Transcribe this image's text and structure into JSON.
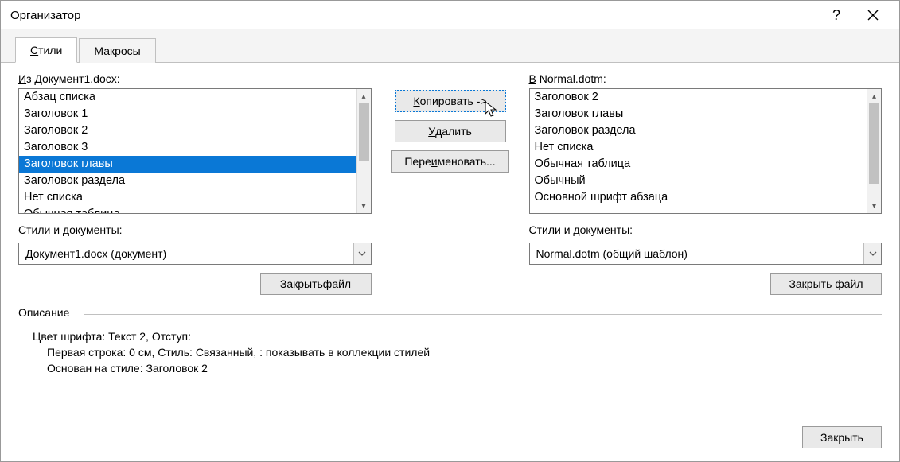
{
  "window": {
    "title": "Организатор",
    "help": "?",
    "close": "✕"
  },
  "tabs": {
    "styles_prefix": "С",
    "styles_rest": "тили",
    "macros_prefix": "М",
    "macros_rest": "акросы"
  },
  "left": {
    "label_prefix": "И",
    "label_rest": "з Документ1.docx:",
    "items": [
      "Абзац списка",
      "Заголовок 1",
      "Заголовок 2",
      "Заголовок 3",
      "Заголовок главы",
      "Заголовок раздела",
      "Нет списка",
      "Обычная таблица"
    ],
    "selected_index": 4,
    "sd_label": "Стили и документы:",
    "sd_value": "Документ1.docx (документ)",
    "close_file_pre": "Закрыть ",
    "close_file_ul": "ф",
    "close_file_post": "айл"
  },
  "mid": {
    "copy_ul": "К",
    "copy_rest": "опировать ->",
    "delete_pre": "",
    "delete_ul": "У",
    "delete_post": "далить",
    "rename_pre": "Пере",
    "rename_ul": "и",
    "rename_post": "меновать..."
  },
  "right": {
    "label_prefix": "В",
    "label_rest": " Normal.dotm:",
    "items": [
      "Заголовок 2",
      "Заголовок главы",
      "Заголовок раздела",
      "Нет списка",
      "Обычная таблица",
      "Обычный",
      "Основной шрифт абзаца"
    ],
    "sd_label": "Стили и документы:",
    "sd_value": "Normal.dotm (общий шаблон)",
    "close_file_pre": "Закрыть фай",
    "close_file_ul": "л",
    "close_file_post": ""
  },
  "description": {
    "legend": "Описание",
    "line1": "Цвет шрифта: Текст 2, Отступ:",
    "line2": "Первая строка:  0 см, Стиль: Связанный, : показывать в коллекции стилей",
    "line3": "Основан на стиле: Заголовок 2"
  },
  "footer": {
    "close": "Закрыть"
  }
}
